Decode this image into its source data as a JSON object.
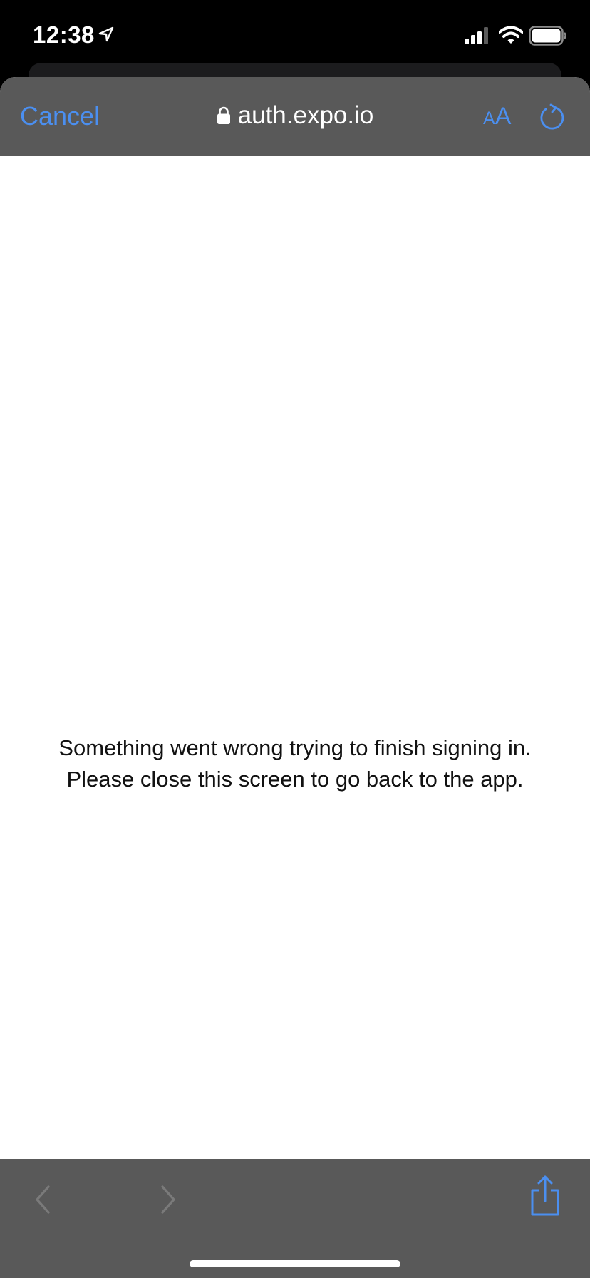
{
  "status_bar": {
    "time": "12:38",
    "icons": [
      "location-arrow-icon",
      "cellular-signal-icon",
      "wifi-icon",
      "battery-icon"
    ]
  },
  "browser": {
    "cancel_label": "Cancel",
    "url": "auth.expo.io",
    "text_size_label_small": "A",
    "text_size_label_large": "A",
    "icons": {
      "lock": "lock-icon",
      "reload": "reload-icon"
    }
  },
  "content": {
    "message_line1": "Something went wrong trying to finish signing in.",
    "message_line2": "Please close this screen to go back to the app."
  },
  "toolbar": {
    "icons": [
      "back-chevron-icon",
      "forward-chevron-icon",
      "share-icon"
    ]
  },
  "colors": {
    "accent": "#4b8ff0",
    "bar_background": "#595959",
    "status_background": "#000000",
    "content_background": "#ffffff"
  }
}
